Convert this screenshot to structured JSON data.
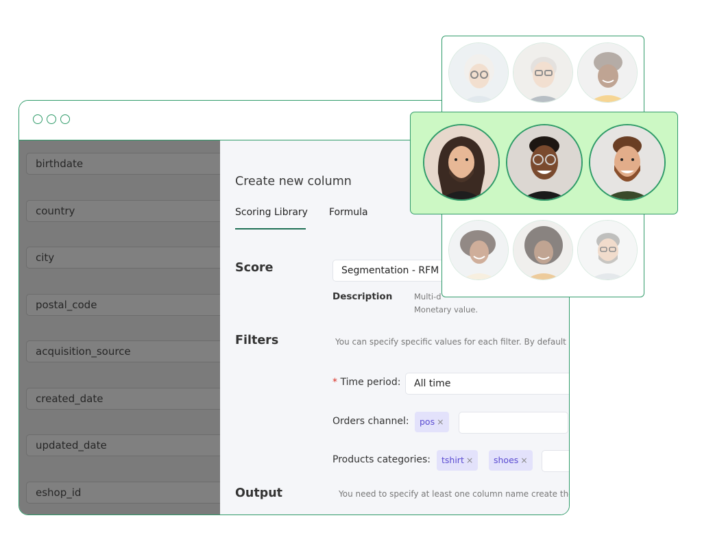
{
  "sidebar": {
    "fields": [
      "birthdate",
      "country",
      "city",
      "postal_code",
      "acquisition_source",
      "created_date",
      "updated_date",
      "eshop_id"
    ]
  },
  "panel": {
    "title": "Create new column",
    "tabs": [
      {
        "label": "Scoring Library",
        "active": true
      },
      {
        "label": "Formula",
        "active": false
      }
    ],
    "score_label": "Score",
    "score_value": "Segmentation - RFM",
    "description_label": "Description",
    "description_line1": "Multi-d",
    "description_line2": "Monetary value.",
    "filters_label": "Filters",
    "filters_hint": "You can specify specific values for each filter. By default n",
    "time_period": {
      "required_mark": "*",
      "label": "Time period:",
      "value": "All time"
    },
    "orders_channel": {
      "label": "Orders channel:",
      "chips": [
        "pos"
      ]
    },
    "products_categories": {
      "label": "Products categories:",
      "chips": [
        "tshirt",
        "shoes"
      ]
    },
    "output_label": "Output",
    "output_hint": "You need to specify at least one column name create the"
  },
  "chip_remove_glyph": "×",
  "avatars": {
    "top_row": [
      "woman-glasses-white-hair",
      "man-glasses-grey-hair",
      "woman-headwrap"
    ],
    "highlighted_row": [
      "man-long-hair-beard",
      "man-glasses-smiling",
      "man-beard-smiling"
    ],
    "bottom_row": [
      "woman-curly-hair",
      "woman-afro",
      "man-glasses-grey-beard"
    ]
  },
  "colors": {
    "accent": "#2e9a68",
    "highlight_bg": "#ccf8c4",
    "chip_bg": "#e3e2fb",
    "chip_text": "#5a4bd1",
    "sidebar_bg": "#7b7b7b"
  }
}
